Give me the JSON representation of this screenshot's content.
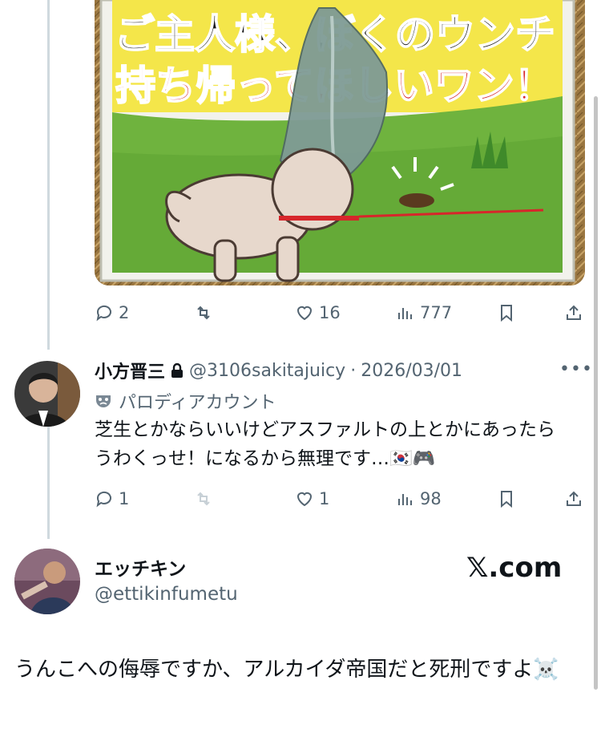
{
  "top_post": {
    "media": {
      "sign_line1": "ご主人様、ぼくのウンチ",
      "sign_line2": "持ち帰ってほしいワン！"
    },
    "actions": {
      "reply_count": "2",
      "repost_count": "",
      "like_count": "16",
      "views_count": "777"
    }
  },
  "reply": {
    "display_name": "小方晋三",
    "handle": "@3106sakitajuicy",
    "separator": "·",
    "date": "2026/03/01",
    "parody_label": "パロディアカウント",
    "text": "芝生とかならいいけどアスファルトの上とかにあったらうわくっせ！になるから無理です…🇰🇷🎮",
    "actions": {
      "reply_count": "1",
      "repost_count": "",
      "like_count": "1",
      "views_count": "98"
    }
  },
  "quoted": {
    "display_name": "エッチキン",
    "handle": "@ettikinfumetu",
    "site_label": "𝕏.com",
    "text": "うんこへの侮辱ですか、アルカイダ帝国だと死刑ですよ☠️"
  },
  "icons": {
    "reply": "reply-bubble-icon",
    "repost": "repost-icon",
    "like": "heart-icon",
    "views": "views-bar-icon",
    "bookmark": "bookmark-icon",
    "share": "share-icon",
    "lock": "lock-icon",
    "parody": "mask-icon",
    "more": "more-dots-icon"
  },
  "colors": {
    "text": "#0f1419",
    "muted": "#536471",
    "thread_line": "#cfd9de",
    "sign_yellow": "#f4e64a",
    "sign_red": "#d7262b",
    "sign_grass": "#6fb33e"
  }
}
